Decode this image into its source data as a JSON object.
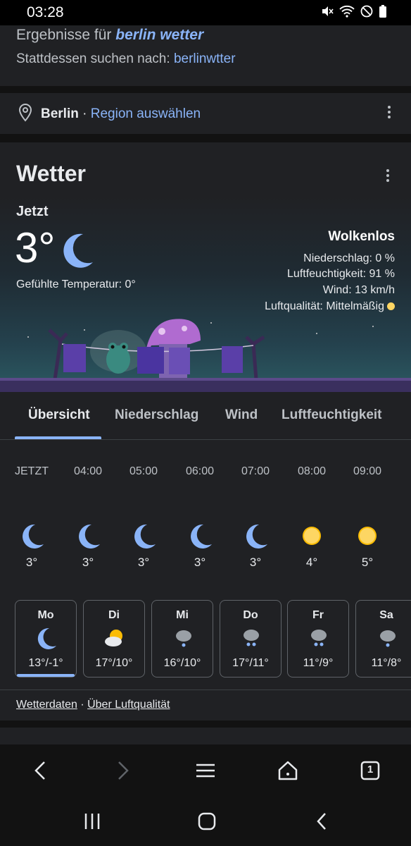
{
  "status": {
    "time": "03:28"
  },
  "search": {
    "results_prefix": "Ergebnisse für ",
    "results_query": "berlin wetter",
    "instead_prefix": "Stattdessen suchen nach: ",
    "instead_query": "berlinwtter"
  },
  "location": {
    "city": "Berlin",
    "separator": " · ",
    "region_link": "Region auswählen"
  },
  "weather": {
    "title": "Wetter",
    "now_label": "Jetzt",
    "temperature": "3°",
    "feels_like": "Gefühlte Temperatur: 0°",
    "condition": "Wolkenlos",
    "precipitation": "Niederschlag: 0 %",
    "humidity": "Luftfeuchtigkeit: 91 %",
    "wind": "Wind: 13 km/h",
    "air_quality": "Luftqualität: Mittelmäßig",
    "colors": {
      "accent": "#8ab4f8",
      "sun": "#fbbc04",
      "moon": "#8ab4f8",
      "aq": "#fdd663"
    }
  },
  "tabs": [
    "Übersicht",
    "Niederschlag",
    "Wind",
    "Luftfeuchtigkeit"
  ],
  "hourly": [
    {
      "time": "JETZT",
      "icon": "moon-icon",
      "temp": "3°"
    },
    {
      "time": "04:00",
      "icon": "moon-icon",
      "temp": "3°"
    },
    {
      "time": "05:00",
      "icon": "moon-icon",
      "temp": "3°"
    },
    {
      "time": "06:00",
      "icon": "moon-icon",
      "temp": "3°"
    },
    {
      "time": "07:00",
      "icon": "moon-icon",
      "temp": "3°"
    },
    {
      "time": "08:00",
      "icon": "sun-icon",
      "temp": "4°"
    },
    {
      "time": "09:00",
      "icon": "sun-icon",
      "temp": "5°"
    }
  ],
  "daily": [
    {
      "day": "Mo",
      "icon": "moon-icon",
      "temps": "13°/-1°"
    },
    {
      "day": "Di",
      "icon": "partly-cloudy-icon",
      "temps": "17°/10°"
    },
    {
      "day": "Mi",
      "icon": "rain-cloud-icon",
      "temps": "16°/10°"
    },
    {
      "day": "Do",
      "icon": "rain-cloud-icon",
      "temps": "17°/11°"
    },
    {
      "day": "Fr",
      "icon": "rain-cloud-icon",
      "temps": "11°/9°"
    },
    {
      "day": "Sa",
      "icon": "rain-cloud-icon",
      "temps": "11°/8°"
    }
  ],
  "links": {
    "data": "Wetterdaten",
    "sep": " · ",
    "aq": "Über Luftqualität"
  },
  "browser": {
    "tab_count": "1"
  }
}
